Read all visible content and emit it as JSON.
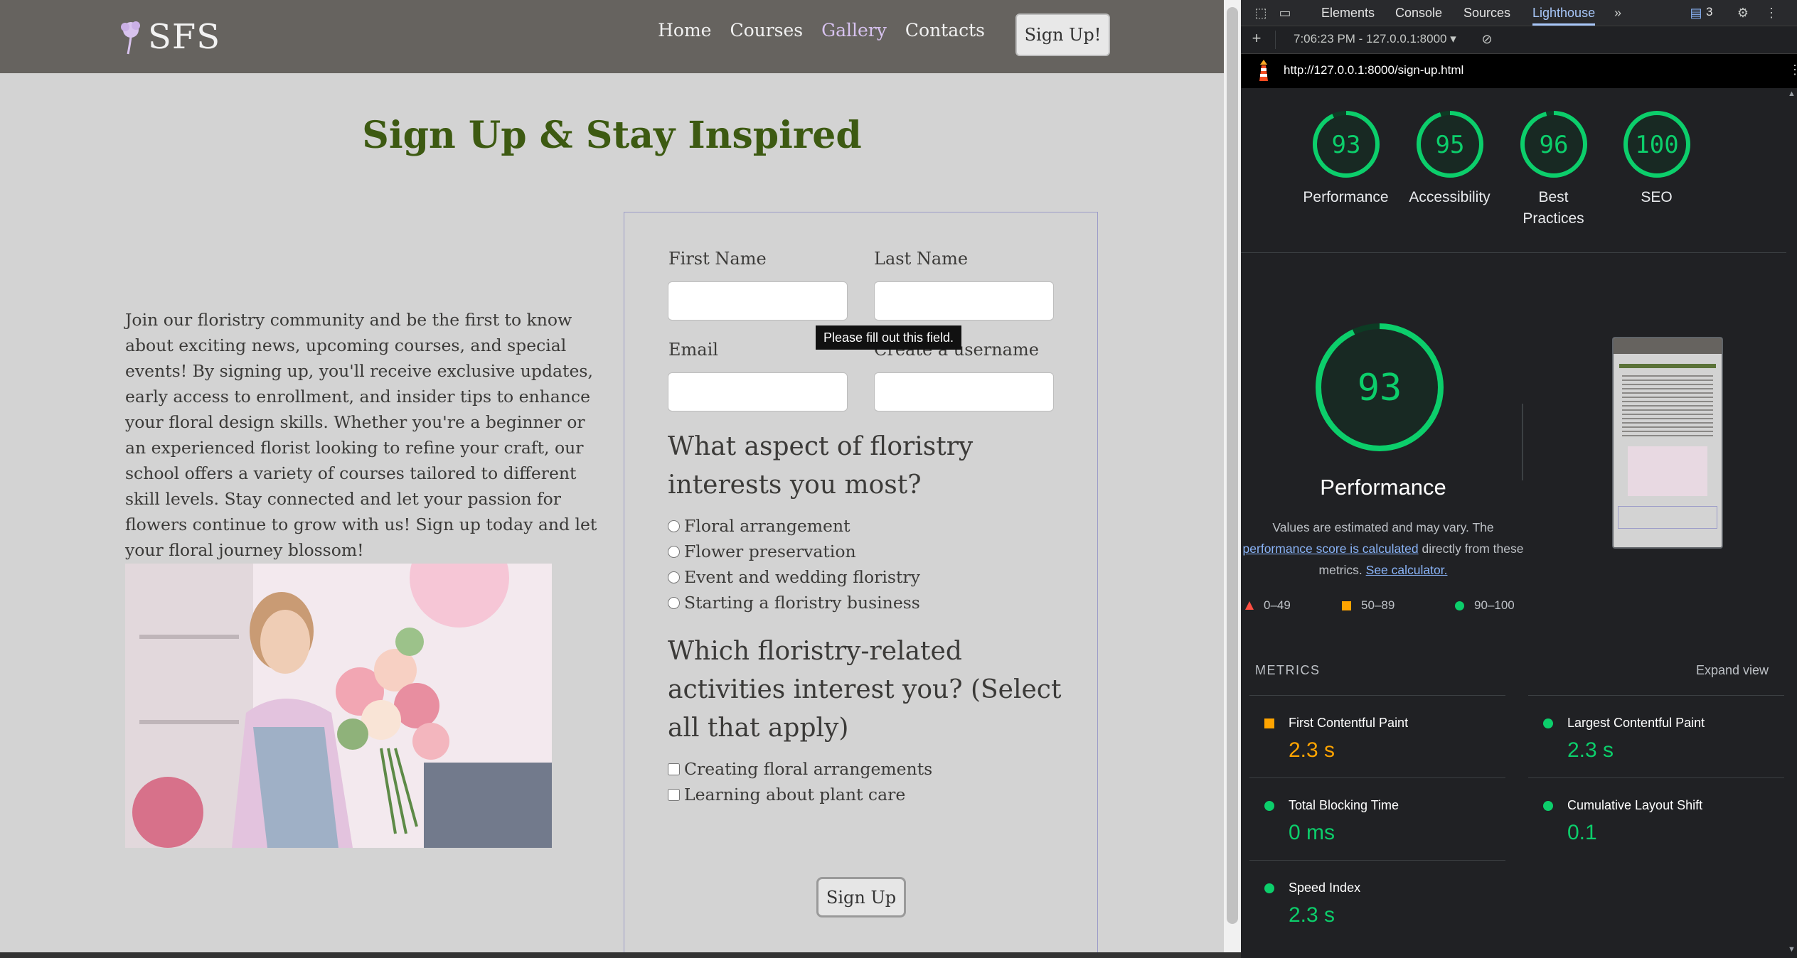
{
  "site": {
    "logo_text": "SFS",
    "nav": [
      "Home",
      "Courses",
      "Gallery",
      "Contacts"
    ],
    "header_button": "Sign Up!",
    "title": "Sign Up & Stay Inspired",
    "intro": "Join our floristry community and be the first to know about exciting news, upcoming courses, and special events! By signing up, you'll receive exclusive updates, early access to enrollment, and insider tips to enhance your floral design skills. Whether you're a beginner or an experienced florist looking to refine your craft, our school offers a variety of courses tailored to different skill levels. Stay connected and let your passion for flowers continue to grow with us! Sign up today and let your floral journey blossom!",
    "form": {
      "first_name_label": "First Name",
      "last_name_label": "Last Name",
      "email_label": "Email",
      "username_label": "Create a username",
      "tooltip": "Please fill out this field.",
      "q1": "What aspect of floristry interests you most?",
      "q1_options": [
        "Floral arrangement",
        "Flower preservation",
        "Event and wedding floristry",
        "Starting a floristry business"
      ],
      "q2": "Which floristry-related activities interest you? (Select all that apply)",
      "q2_options": [
        "Creating floral arrangements",
        "Learning about plant care"
      ],
      "submit": "Sign Up"
    }
  },
  "devtools": {
    "tabs": [
      "Elements",
      "Console",
      "Sources",
      "Lighthouse"
    ],
    "active_tab": "Lighthouse",
    "issues_count": "3",
    "report_select": "7:06:23 PM - 127.0.0.1:8000",
    "url": "http://127.0.0.1:8000/sign-up.html",
    "scores": [
      {
        "label": "Performance",
        "value": 93
      },
      {
        "label": "Accessibility",
        "value": 95
      },
      {
        "label": "Best Practices",
        "value": 96
      },
      {
        "label": "SEO",
        "value": 100
      }
    ],
    "performance_score": 93,
    "performance_title": "Performance",
    "desc_part1": "Values are estimated and may vary. The",
    "desc_link1": "performance score is calculated",
    "desc_part2": "directly from these metrics.",
    "desc_link2": "See calculator.",
    "legend": [
      "0–49",
      "50–89",
      "90–100"
    ],
    "metrics_label": "METRICS",
    "expand_view": "Expand view",
    "metrics": [
      {
        "name": "First Contentful Paint",
        "value": "2.3 s",
        "status": "average"
      },
      {
        "name": "Largest Contentful Paint",
        "value": "2.3 s",
        "status": "pass"
      },
      {
        "name": "Total Blocking Time",
        "value": "0 ms",
        "status": "pass"
      },
      {
        "name": "Cumulative Layout Shift",
        "value": "0.1",
        "status": "pass"
      },
      {
        "name": "Speed Index",
        "value": "2.3 s",
        "status": "pass"
      }
    ],
    "colors": {
      "pass": "#0cce6b",
      "average": "#ffa400",
      "fail": "#ff4e42"
    }
  }
}
